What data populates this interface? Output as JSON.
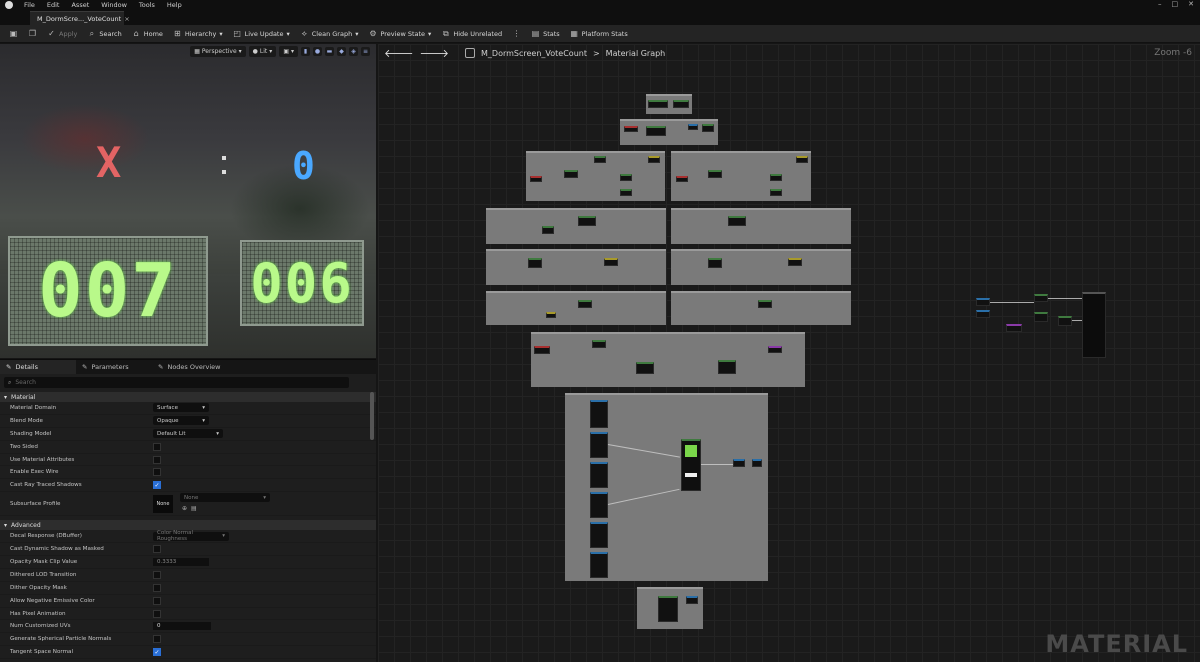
{
  "menu": {
    "items": [
      "File",
      "Edit",
      "Asset",
      "Window",
      "Tools",
      "Help"
    ]
  },
  "tab": {
    "title": "M_DormScre..._VoteCount",
    "close": "×"
  },
  "toolbar": {
    "apply": "Apply",
    "search": "Search",
    "home": "Home",
    "hierarchy": "Hierarchy",
    "live_update": "Live Update",
    "clean_graph": "Clean Graph",
    "preview_state": "Preview State",
    "hide_unrelated": "Hide Unrelated",
    "stats": "Stats",
    "platform_stats": "Platform Stats"
  },
  "viewport": {
    "perspective": "Perspective",
    "lit": "Lit",
    "scene": {
      "left_symbol": "X",
      "right_symbol": "0",
      "left_score": "007",
      "right_score": "006"
    }
  },
  "panel": {
    "tabs": [
      "Details",
      "Parameters",
      "Nodes Overview"
    ],
    "search_placeholder": "Search",
    "category_material": "Material",
    "category_advanced": "Advanced",
    "material_rows": [
      {
        "label": "Material Domain",
        "value": "Surface"
      },
      {
        "label": "Blend Mode",
        "value": "Opaque"
      },
      {
        "label": "Shading Model",
        "value": "Default Lit"
      },
      {
        "label": "Two Sided",
        "checked": false
      },
      {
        "label": "Use Material Attributes",
        "checked": false
      },
      {
        "label": "Enable Exec Wire",
        "checked": false
      },
      {
        "label": "Cast Ray Traced Shadows",
        "checked": true
      }
    ],
    "subsurface": {
      "label": "Subsurface Profile",
      "thumb": "None",
      "value": "None"
    },
    "advanced_rows": [
      {
        "label": "Decal Response (DBuffer)",
        "value": "Color Normal Roughness"
      },
      {
        "label": "Cast Dynamic Shadow as Masked",
        "checked": false
      },
      {
        "label": "Opacity Mask Clip Value",
        "value": "0.3333"
      },
      {
        "label": "Dithered LOD Transition",
        "checked": false
      },
      {
        "label": "Dither Opacity Mask",
        "checked": false
      },
      {
        "label": "Allow Negative Emissive Color",
        "checked": false
      },
      {
        "label": "Has Pixel Animation",
        "checked": false
      },
      {
        "label": "Num Customized UVs",
        "value": "0"
      },
      {
        "label": "Generate Spherical Particle Normals",
        "checked": false
      },
      {
        "label": "Tangent Space Normal",
        "checked": true
      }
    ]
  },
  "graph": {
    "breadcrumb_asset": "M_DormScreen_VoteCount",
    "breadcrumb_sep": ">",
    "breadcrumb_graph": "Material Graph",
    "zoom": "Zoom -6",
    "watermark": "MATERIAL"
  }
}
